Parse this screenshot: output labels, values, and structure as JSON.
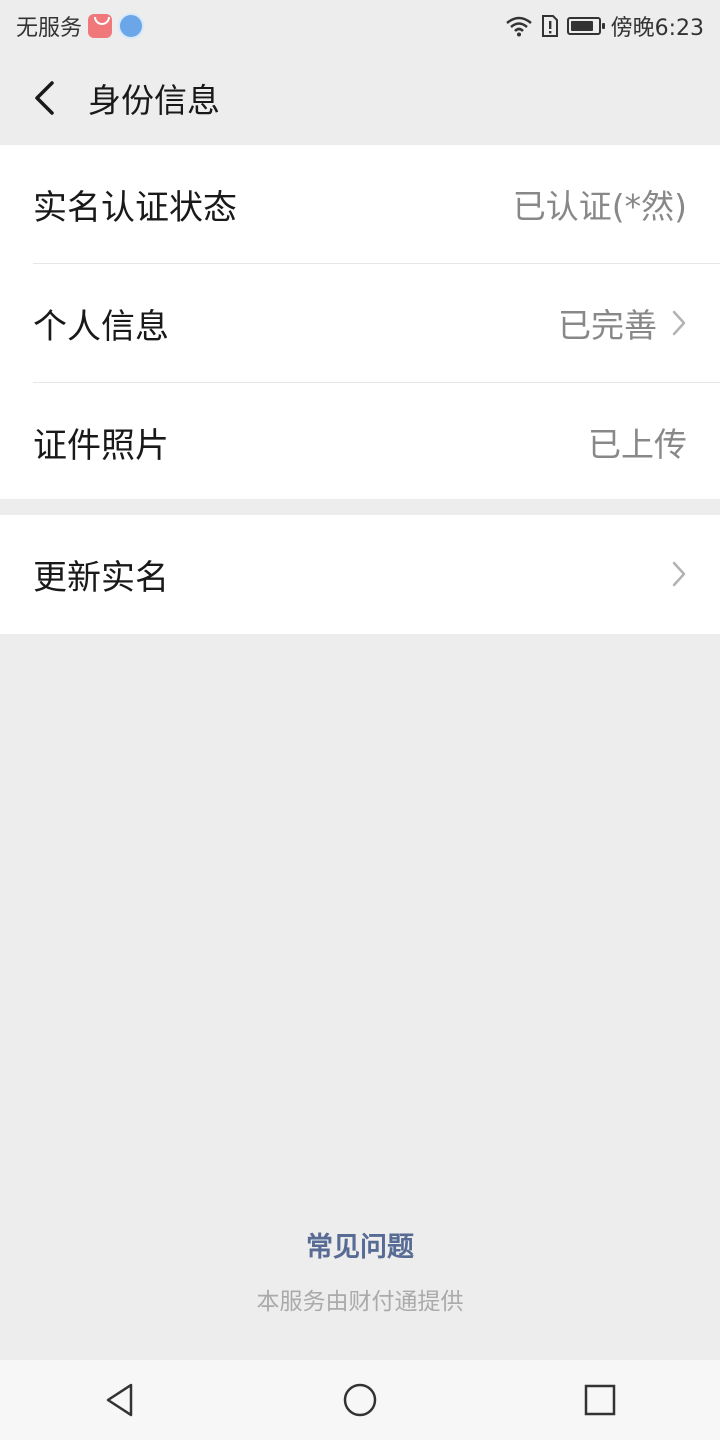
{
  "status_bar": {
    "carrier": "无服务",
    "time": "傍晚6:23",
    "icons": [
      "app-store-icon",
      "browser-icon",
      "wifi-icon",
      "sim-alert-icon",
      "battery-icon"
    ]
  },
  "nav": {
    "title": "身份信息",
    "back_icon": "chevron-left-icon"
  },
  "identity": {
    "rows": [
      {
        "label": "实名认证状态",
        "value": "已认证(*然)",
        "has_arrow": false
      },
      {
        "label": "个人信息",
        "value": "已完善",
        "has_arrow": true
      },
      {
        "label": "证件照片",
        "value": "已上传",
        "has_arrow": false
      }
    ]
  },
  "update": {
    "label": "更新实名",
    "has_arrow": true
  },
  "footer": {
    "faq_label": "常见问题",
    "provider_text": "本服务由财付通提供"
  },
  "system_nav": {
    "icons": [
      "back-triangle-icon",
      "home-circle-icon",
      "recents-square-icon"
    ]
  },
  "colors": {
    "background": "#ededed",
    "card": "#ffffff",
    "link": "#576b95",
    "secondary_text": "#888888"
  }
}
